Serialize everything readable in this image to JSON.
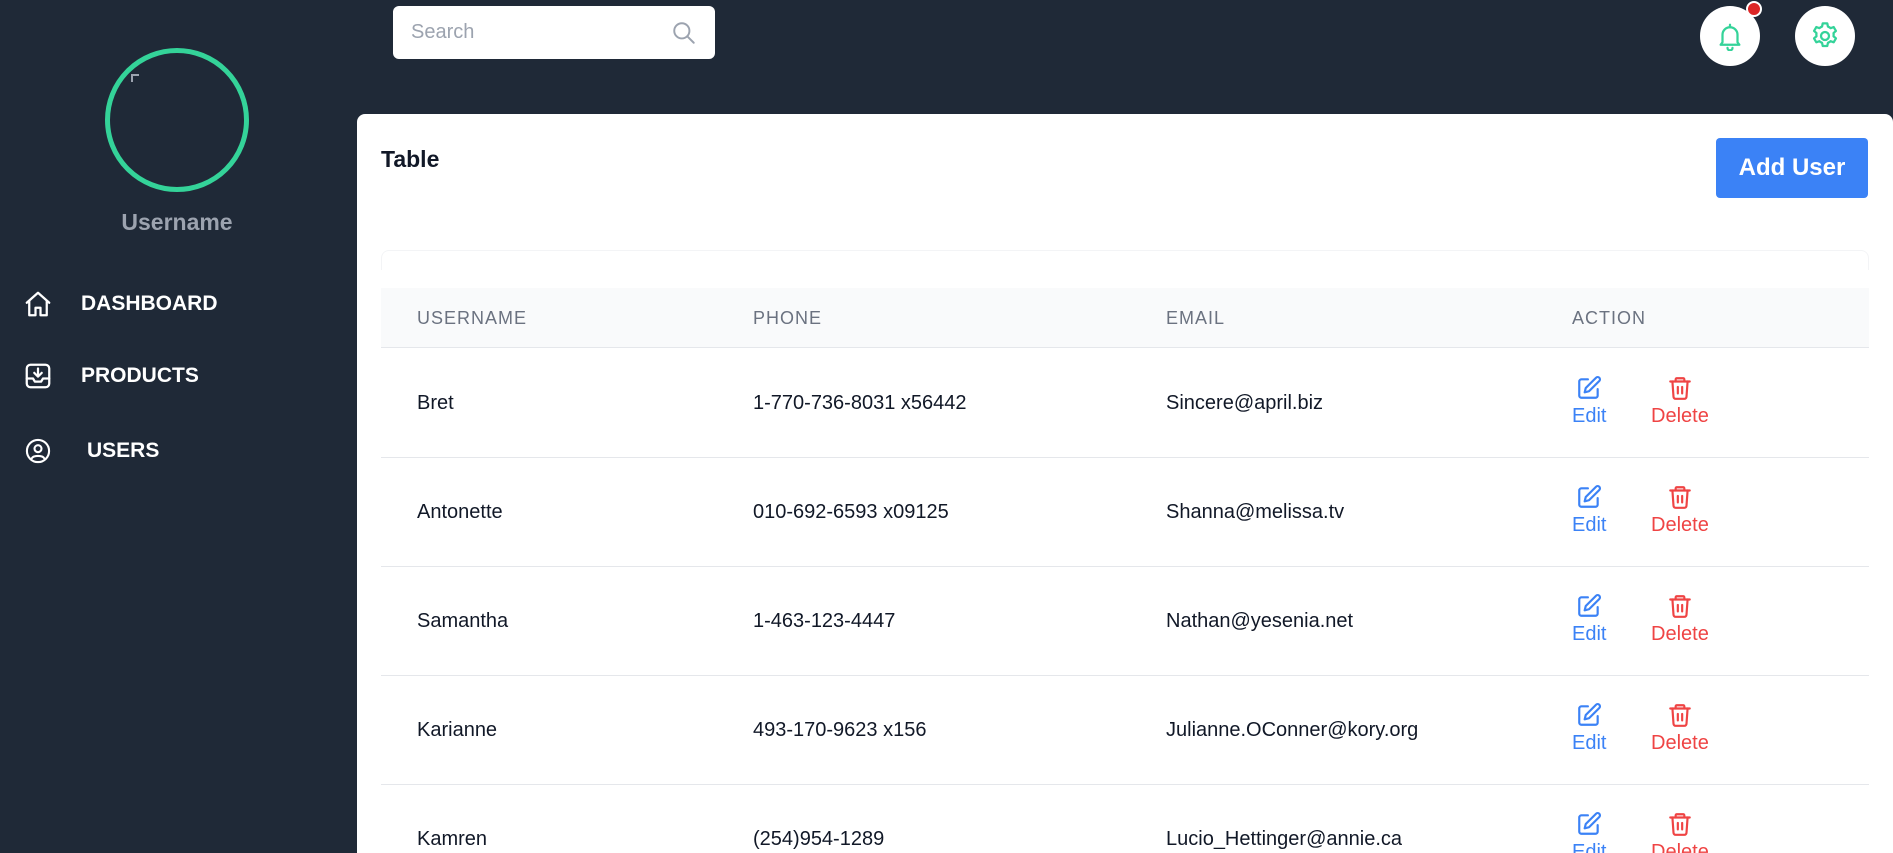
{
  "sidebar": {
    "username": "Username",
    "items": [
      {
        "label": "DASHBOARD",
        "icon": "home-icon"
      },
      {
        "label": "PRODUCTS",
        "icon": "inbox-download-icon"
      },
      {
        "label": "USERS",
        "icon": "user-circle-icon"
      }
    ]
  },
  "topbar": {
    "search_placeholder": "Search",
    "search_value": "",
    "notification_icon": "bell-icon",
    "settings_icon": "gear-icon"
  },
  "main": {
    "title": "Table",
    "add_button_label": "Add User",
    "columns": [
      "USERNAME",
      "PHONE",
      "EMAIL",
      "ACTION"
    ],
    "rows": [
      {
        "username": "Bret",
        "phone": "1-770-736-8031 x56442",
        "email": "Sincere@april.biz"
      },
      {
        "username": "Antonette",
        "phone": "010-692-6593 x09125",
        "email": "Shanna@melissa.tv"
      },
      {
        "username": "Samantha",
        "phone": "1-463-123-4447",
        "email": "Nathan@yesenia.net"
      },
      {
        "username": "Karianne",
        "phone": "493-170-9623 x156",
        "email": "Julianne.OConner@kory.org"
      },
      {
        "username": "Kamren",
        "phone": "(254)954-1289",
        "email": "Lucio_Hettinger@annie.ca"
      }
    ],
    "edit_label": "Edit",
    "delete_label": "Delete"
  },
  "colors": {
    "background": "#1f2937",
    "accent_green": "#34d399",
    "primary_blue": "#3b82f6",
    "danger_red": "#ef4444"
  }
}
